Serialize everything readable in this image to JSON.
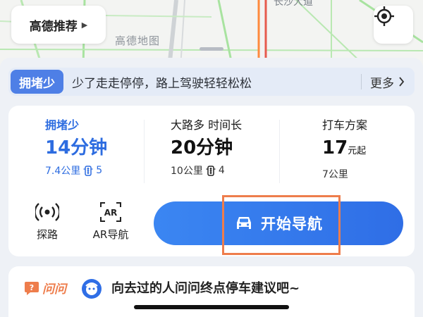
{
  "map": {
    "recommend_label": "高德推荐",
    "watermark": "高德地图",
    "road_label": "长沙大道"
  },
  "tip": {
    "badge": "拥堵少",
    "text": "少了走走停停，路上驾驶轻轻松松",
    "more": "更多"
  },
  "routes": [
    {
      "tag": "拥堵少",
      "time": "14分钟",
      "distance": "7.4公里",
      "lights": "5"
    },
    {
      "tag": "大路多 时间长",
      "time": "20分钟",
      "distance": "10公里",
      "lights": "4"
    },
    {
      "tag": "打车方案",
      "time": "17",
      "time_unit": "元起",
      "distance": "7公里"
    }
  ],
  "tools": {
    "probe_label": "探路",
    "ar_label": "AR导航",
    "ar_icon_text": "AR"
  },
  "nav_button": {
    "label": "开始导航"
  },
  "ask": {
    "brand": "问问",
    "text": "向去过的人问问终点停车建议吧~"
  },
  "colors": {
    "accent": "#2d6ce0",
    "nav_button": "#3b86f2",
    "highlight": "#ee7d4c",
    "tip_badge": "#4e7fe6"
  }
}
